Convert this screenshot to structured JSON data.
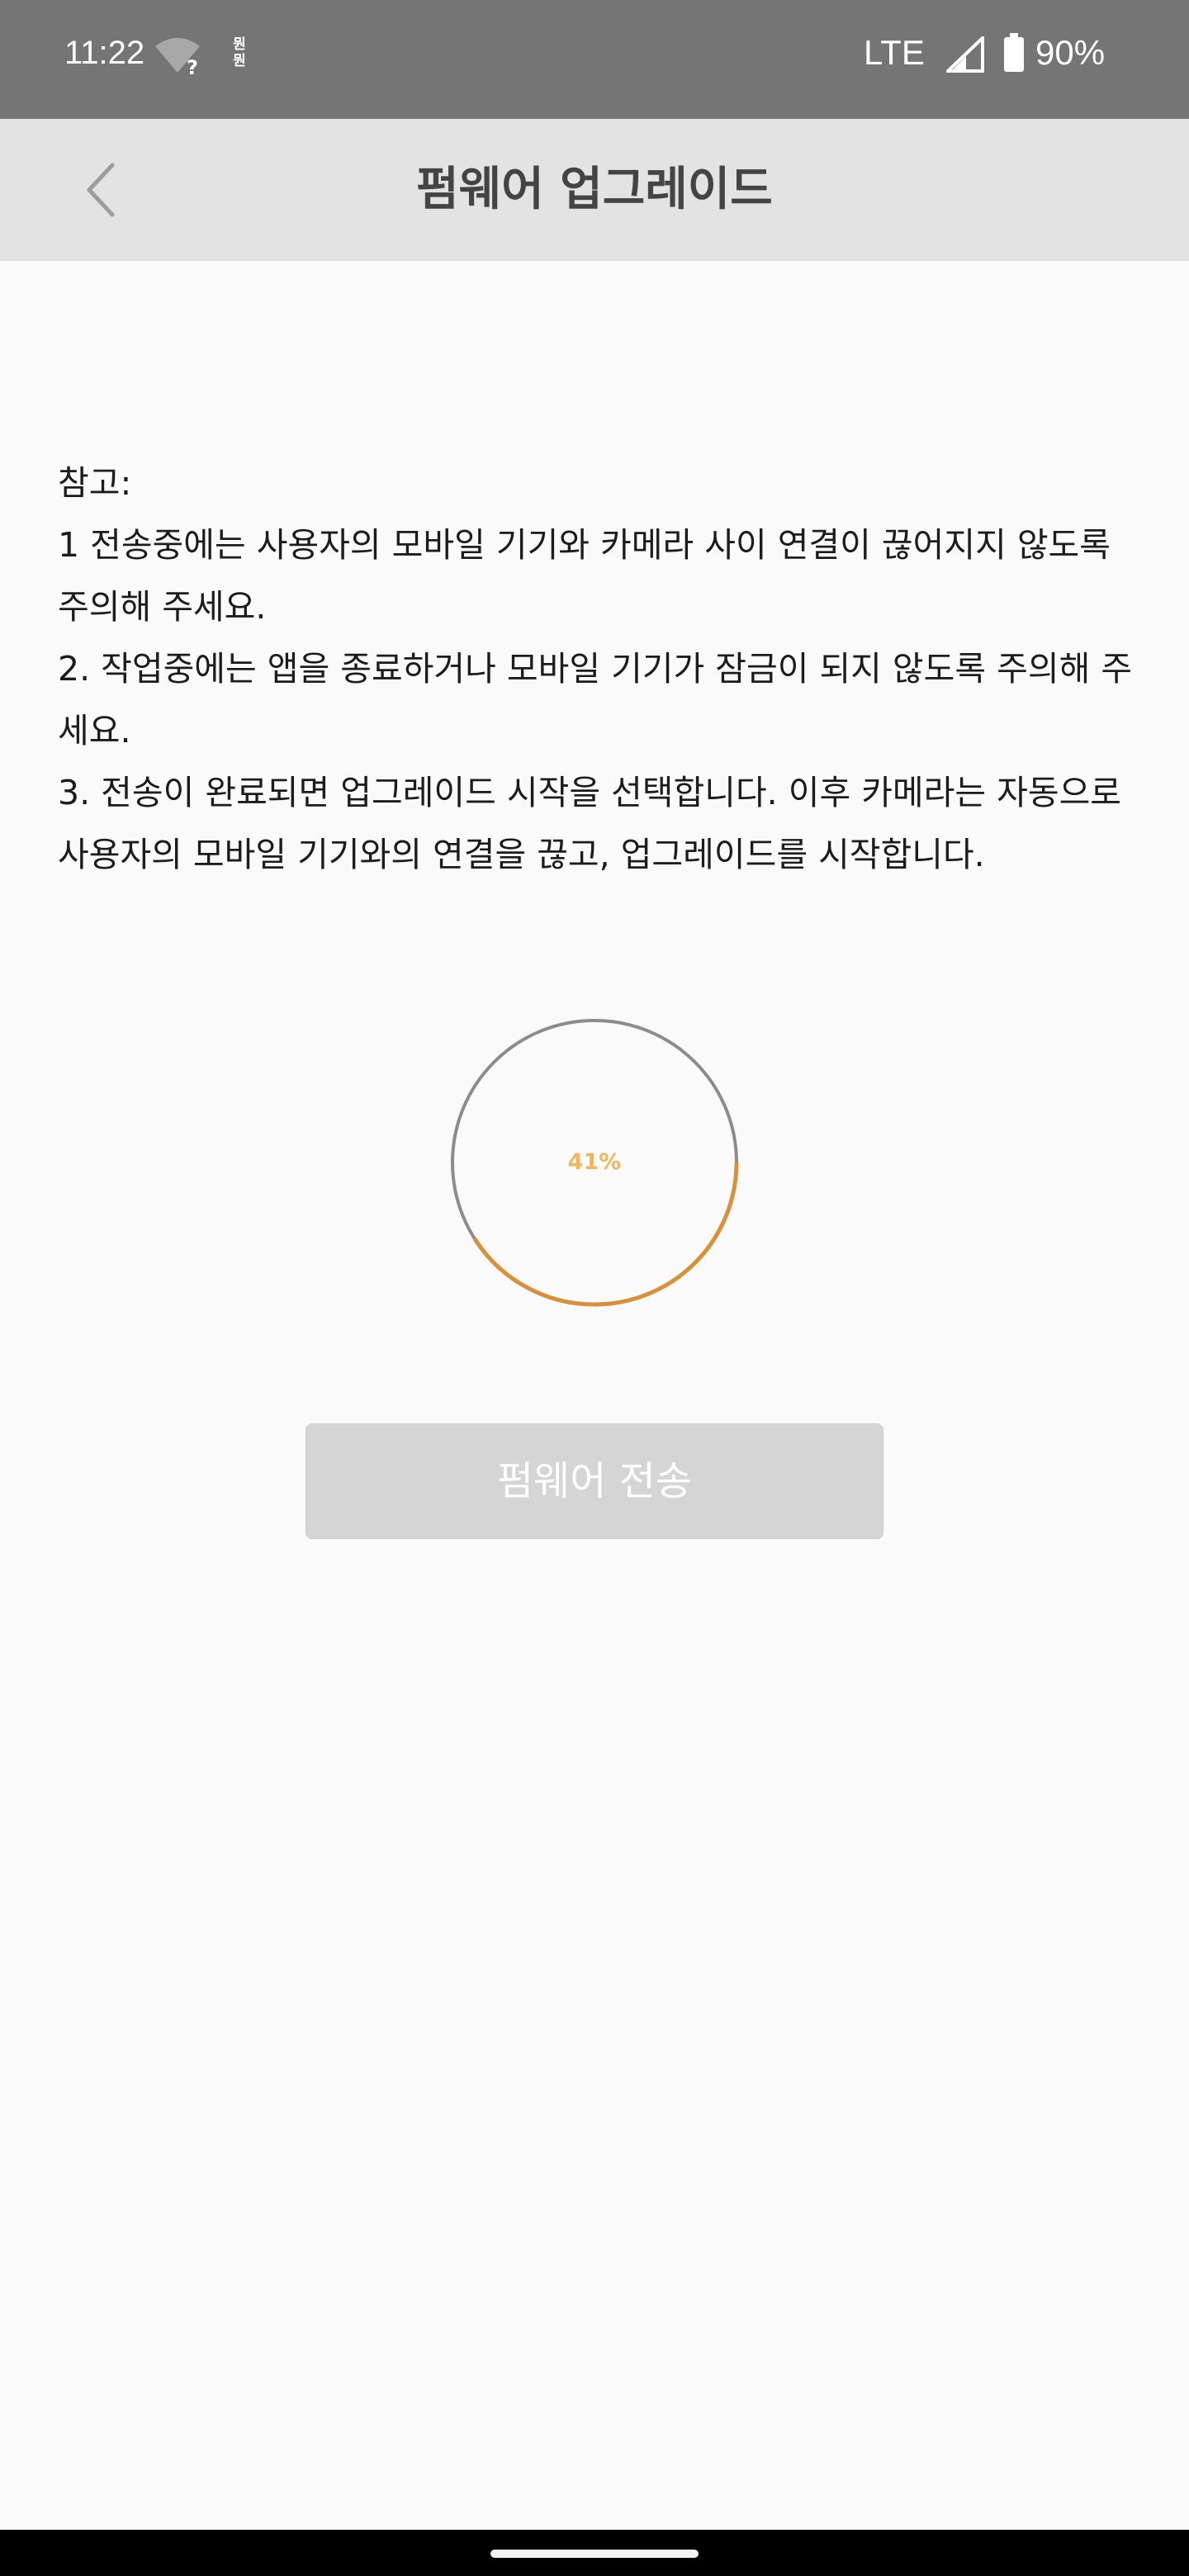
{
  "status_bar": {
    "time": "11:22",
    "notification_text": "뭔\n뭔",
    "network": "LTE",
    "battery": "90%",
    "icons": [
      "wifi-question-icon",
      "notification-icon",
      "signal-icon",
      "battery-icon"
    ]
  },
  "app_bar": {
    "back_icon": "chevron-left-icon",
    "title": "펌웨어 업그레이드"
  },
  "notes": {
    "heading": "참고:",
    "items": [
      "1 전송중에는 사용자의 모바일 기기와 카메라 사이 연결이 끊어지지 않도록 주의해 주세요.",
      "2. 작업중에는 앱을 종료하거나 모바일 기기가 잠금이 되지 않도록 주의해 주세요.",
      "3. 전송이 완료되면 업그레이드 시작을 선택합니다. 이후 카메라는 자동으로 사용자의 모바일 기기와의 연결을 끊고, 업그레이드를 시작합니다."
    ]
  },
  "progress": {
    "label": "41%",
    "value": 0.41,
    "track_color": "#8c8c8c",
    "fill_color": "#d9903a"
  },
  "transfer_button": {
    "label": "펌웨어 전송",
    "enabled": false
  },
  "colors": {
    "status_bar": "#757575",
    "app_bar": "#e3e3e3",
    "background": "#fafafa",
    "button_disabled": "#d5d5d5"
  }
}
